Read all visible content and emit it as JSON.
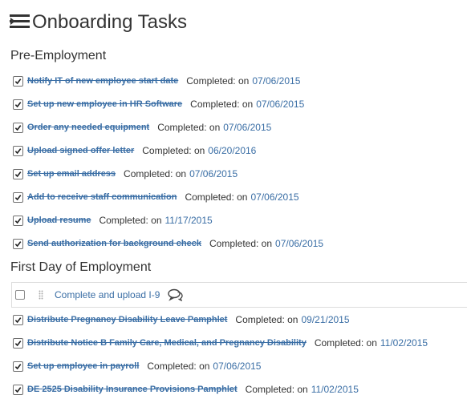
{
  "header": {
    "title": "Onboarding Tasks",
    "icon": "task-list-icon"
  },
  "sections": [
    {
      "title": "Pre-Employment",
      "tasks": [
        {
          "name": "Notify IT of new employee start date",
          "status": "Completed: on",
          "date": "07/06/2015"
        },
        {
          "name": "Set up new employee in HR Software",
          "status": "Completed: on",
          "date": "07/06/2015"
        },
        {
          "name": "Order any needed equipment",
          "status": "Completed: on",
          "date": "07/06/2015"
        },
        {
          "name": "Upload signed offer letter",
          "status": "Completed: on",
          "date": "06/20/2016"
        },
        {
          "name": "Set up email address",
          "status": "Completed: on",
          "date": "07/06/2015"
        },
        {
          "name": "Add to receive staff communication",
          "status": "Completed: on",
          "date": "07/06/2015"
        },
        {
          "name": "Upload resume",
          "status": "Completed: on",
          "date": "11/17/2015"
        },
        {
          "name": "Send authorization for background check",
          "status": "Completed: on",
          "date": "07/06/2015"
        }
      ]
    },
    {
      "title": "First Day of Employment",
      "pending": {
        "name": "Complete and upload I-9",
        "icons": [
          "drag-handle-icon",
          "comment-icon"
        ]
      },
      "tasks": [
        {
          "name": "Distribute Pregnancy Disability Leave Pamphlet",
          "status": "Completed: on",
          "date": "09/21/2015"
        },
        {
          "name": "Distribute Notice B Family Care, Medical, and Pregnancy Disability",
          "status": "Completed: on",
          "date": "11/02/2015"
        },
        {
          "name": "Set up employee in payroll",
          "status": "Completed: on",
          "date": "07/06/2015"
        },
        {
          "name": "DE 2525 Disability Insurance Provisions Pamphlet",
          "status": "Completed: on",
          "date": "11/02/2015"
        }
      ]
    }
  ],
  "colors": {
    "link": "#3a6ea5",
    "text": "#333333",
    "border": "#dddddd"
  }
}
